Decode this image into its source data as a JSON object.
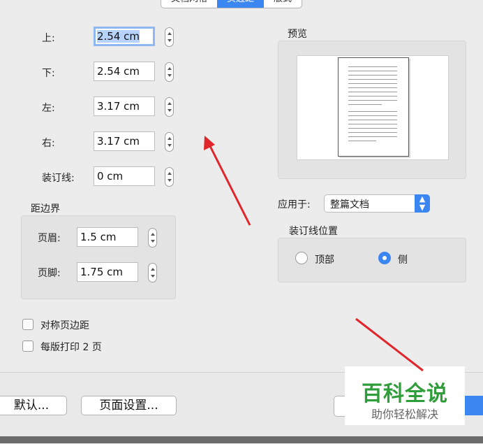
{
  "tabs": [
    {
      "label": "文档网格",
      "active": false
    },
    {
      "label": "页边距",
      "active": true
    },
    {
      "label": "版式",
      "active": false
    }
  ],
  "margins": {
    "top_label": "上:",
    "top_value": "2.54 cm",
    "bottom_label": "下:",
    "bottom_value": "2.54 cm",
    "left_label": "左:",
    "left_value": "3.17 cm",
    "right_label": "右:",
    "right_value": "3.17 cm",
    "gutter_label": "装订线:",
    "gutter_value": "0 cm"
  },
  "from_edge": {
    "title": "距边界",
    "header_label": "页眉:",
    "header_value": "1.5 cm",
    "footer_label": "页脚:",
    "footer_value": "1.75 cm"
  },
  "checkboxes": {
    "mirror_label": "对称页边距",
    "mirror_checked": false,
    "two_pages_label": "每版打印 2 页",
    "two_pages_checked": false
  },
  "preview": {
    "title": "预览"
  },
  "apply_to": {
    "label": "应用于:",
    "value": "整篇文档"
  },
  "gutter_position": {
    "title": "装订线位置",
    "top_label": "顶部",
    "top_selected": false,
    "side_label": "侧",
    "side_selected": true
  },
  "buttons": {
    "default_label": "默认...",
    "page_setup_label": "页面设置..."
  },
  "watermark": {
    "title": "百科全说",
    "subtitle": "助你轻松解决"
  },
  "colors": {
    "accent": "#3b86f0",
    "arrow": "#e0262a",
    "watermark_green": "#2e9d3a"
  }
}
